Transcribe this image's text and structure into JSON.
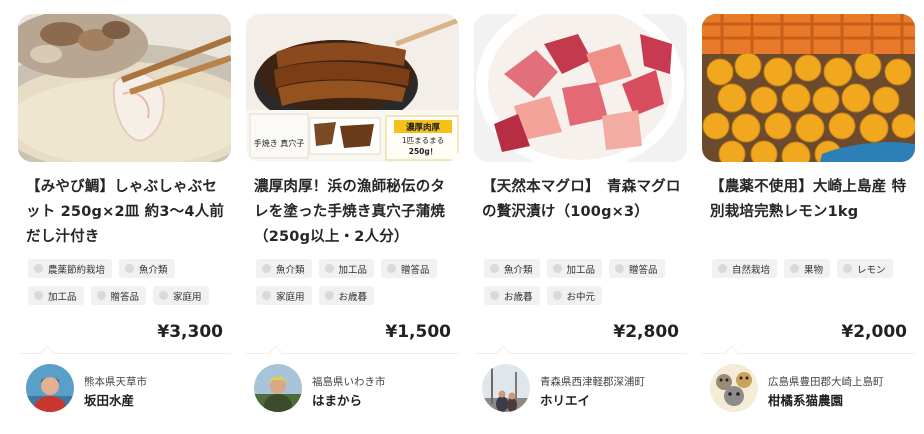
{
  "products": [
    {
      "title": "【みやび鯛】しゃぶしゃぶセット 250g×2皿 約3～4人前 だし汁付き",
      "tags": [
        "農薬節約栽培",
        "魚介類",
        "加工品",
        "贈答品",
        "家庭用"
      ],
      "price": "¥3,300",
      "seller": {
        "location": "熊本県天草市",
        "name": "坂田水産"
      }
    },
    {
      "title": "濃厚肉厚！浜の漁師秘伝のタレを塗った手焼き真穴子蒲焼（250g以上・2人分）",
      "image_text": {
        "banner": "濃厚肉厚",
        "sub1": "1匹まるまる",
        "sub2": "250g！",
        "badge": "手焼き 真穴子"
      },
      "tags": [
        "魚介類",
        "加工品",
        "贈答品",
        "家庭用",
        "お歳暮"
      ],
      "price": "¥1,500",
      "seller": {
        "location": "福島県いわき市",
        "name": "はまから"
      }
    },
    {
      "title": "【天然本マグロ】　青森マグロの贅沢漬け（100g×3）",
      "tags": [
        "魚介類",
        "加工品",
        "贈答品",
        "お歳暮",
        "お中元"
      ],
      "price": "¥2,800",
      "seller": {
        "location": "青森県西津軽郡深浦町",
        "name": "ホリエイ"
      }
    },
    {
      "title": "【農薬不使用】大崎上島産 特別栽培完熟レモン1kg",
      "tags": [
        "自然栽培",
        "果物",
        "レモン"
      ],
      "price": "¥2,000",
      "seller": {
        "location": "広島県豊田郡大崎上島町",
        "name": "柑橘系猫農園"
      }
    }
  ]
}
